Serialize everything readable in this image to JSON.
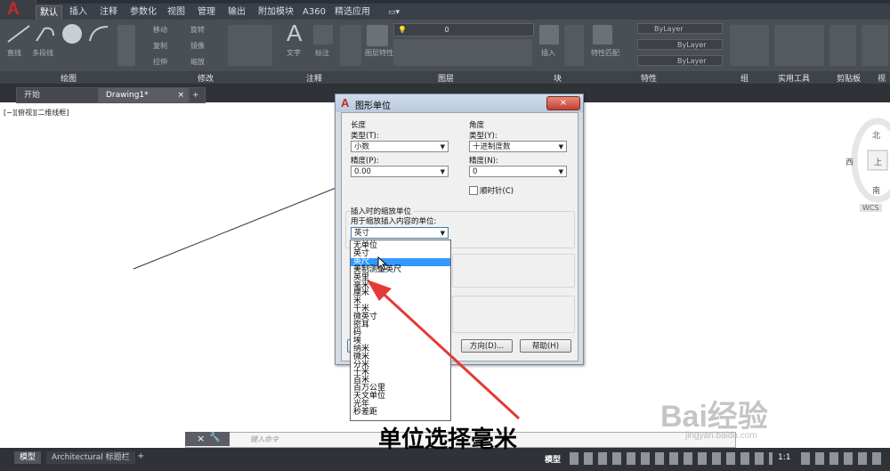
{
  "ribbon": {
    "tabs": [
      "默认",
      "插入",
      "注释",
      "参数化",
      "视图",
      "管理",
      "输出",
      "附加模块",
      "A360",
      "精选应用"
    ],
    "panels": [
      "绘图",
      "修改",
      "注释",
      "图层",
      "块",
      "特性",
      "组",
      "实用工具",
      "剪贴板",
      "视图"
    ],
    "tools": {
      "line": "直线",
      "polyline": "多段线",
      "move": "移动",
      "rotate": "旋转",
      "copy": "复制",
      "mirror": "镜像",
      "stretch": "拉伸",
      "scale": "缩放",
      "text": "文字",
      "dim": "标注",
      "layer_props": "图层特性",
      "insert": "插入",
      "match": "特性匹配",
      "bylayer1": "ByLayer",
      "bylayer2": "ByLayer",
      "bylayer3": "ByLayer",
      "layer_value": "0"
    }
  },
  "doc_tabs": [
    "开始",
    "Drawing1*"
  ],
  "viewport_label": "[−][俯视][二维线框]",
  "viewcube": {
    "north": "北",
    "west": "西",
    "top": "上",
    "south": "南",
    "wcs": "WCS"
  },
  "dialog": {
    "title": "图形单位",
    "length_group": "长度",
    "length_type_label": "类型(T):",
    "length_type_value": "小数",
    "length_precision_label": "精度(P):",
    "length_precision_value": "0.00",
    "angle_group": "角度",
    "angle_type_label": "类型(Y):",
    "angle_type_value": "十进制度数",
    "angle_precision_label": "精度(N):",
    "angle_precision_value": "0",
    "clockwise_label": "顺时针(C)",
    "insert_group": "插入时的缩放单位",
    "insert_desc": "用于缩放插入内容的单位:",
    "insert_value": "英寸",
    "direction_button": "方向(D)...",
    "help_button": "帮助(H)"
  },
  "dropdown_options": [
    "无单位",
    "英寸",
    "英尺",
    "美制测量英尺",
    "英里",
    "毫米",
    "厘米",
    "米",
    "千米",
    "微英寸",
    "密耳",
    "码",
    "埃",
    "纳米",
    "微米",
    "分米",
    "十米",
    "百米",
    "百万公里",
    "天文单位",
    "光年",
    "秒差距"
  ],
  "dropdown_highlight_index": 2,
  "command_line": {
    "placeholder": "键入命令"
  },
  "status": {
    "model_tab": "模型",
    "layout_tab": "Architectural 标题栏",
    "model_btn": "模型",
    "scale": "1:1"
  },
  "caption": "单位选择毫米",
  "watermark": {
    "brand": "Bai经验",
    "url": "jingyan.baidu.com"
  },
  "colors": {
    "accent_red": "#e53935",
    "highlight": "#3399ff",
    "ribbon_bg": "#4a4f56"
  }
}
